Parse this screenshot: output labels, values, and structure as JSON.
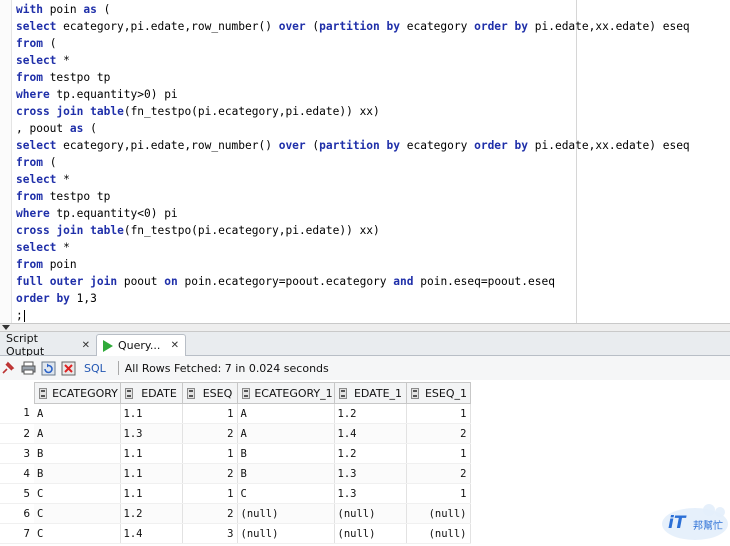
{
  "editor": {
    "lines": [
      [
        {
          "t": "with",
          "k": 1
        },
        {
          "t": " poin "
        },
        {
          "t": "as",
          "k": 1
        },
        {
          "t": " ("
        }
      ],
      [
        {
          "t": "select",
          "k": 1
        },
        {
          "t": " ecategory,pi.edate,row_number() "
        },
        {
          "t": "over",
          "k": 1
        },
        {
          "t": " ("
        },
        {
          "t": "partition",
          "k": 1
        },
        {
          "t": " "
        },
        {
          "t": "by",
          "k": 1
        },
        {
          "t": " ecategory "
        },
        {
          "t": "order",
          "k": 1
        },
        {
          "t": " "
        },
        {
          "t": "by",
          "k": 1
        },
        {
          "t": " pi.edate,xx.edate) eseq"
        }
      ],
      [
        {
          "t": "from",
          "k": 1
        },
        {
          "t": " ("
        }
      ],
      [
        {
          "t": "select",
          "k": 1
        },
        {
          "t": " *"
        }
      ],
      [
        {
          "t": "from",
          "k": 1
        },
        {
          "t": " testpo tp"
        }
      ],
      [
        {
          "t": "where",
          "k": 1
        },
        {
          "t": " tp.equantity>0) pi"
        }
      ],
      [
        {
          "t": "cross",
          "k": 1
        },
        {
          "t": " "
        },
        {
          "t": "join",
          "k": 1
        },
        {
          "t": " "
        },
        {
          "t": "table",
          "k": 1
        },
        {
          "t": "(fn_testpo(pi.ecategory,pi.edate)) xx)"
        }
      ],
      [
        {
          "t": ", poout "
        },
        {
          "t": "as",
          "k": 1
        },
        {
          "t": " ("
        }
      ],
      [
        {
          "t": "select",
          "k": 1
        },
        {
          "t": " ecategory,pi.edate,row_number() "
        },
        {
          "t": "over",
          "k": 1
        },
        {
          "t": " ("
        },
        {
          "t": "partition",
          "k": 1
        },
        {
          "t": " "
        },
        {
          "t": "by",
          "k": 1
        },
        {
          "t": " ecategory "
        },
        {
          "t": "order",
          "k": 1
        },
        {
          "t": " "
        },
        {
          "t": "by",
          "k": 1
        },
        {
          "t": " pi.edate,xx.edate) eseq"
        }
      ],
      [
        {
          "t": "from",
          "k": 1
        },
        {
          "t": " ("
        }
      ],
      [
        {
          "t": "select",
          "k": 1
        },
        {
          "t": " *"
        }
      ],
      [
        {
          "t": "from",
          "k": 1
        },
        {
          "t": " testpo tp"
        }
      ],
      [
        {
          "t": "where",
          "k": 1
        },
        {
          "t": " tp.equantity<0) pi"
        }
      ],
      [
        {
          "t": "cross",
          "k": 1
        },
        {
          "t": " "
        },
        {
          "t": "join",
          "k": 1
        },
        {
          "t": " "
        },
        {
          "t": "table",
          "k": 1
        },
        {
          "t": "(fn_testpo(pi.ecategory,pi.edate)) xx)"
        }
      ],
      [
        {
          "t": "select",
          "k": 1
        },
        {
          "t": " *"
        }
      ],
      [
        {
          "t": "from",
          "k": 1
        },
        {
          "t": " poin"
        }
      ],
      [
        {
          "t": "full",
          "k": 1
        },
        {
          "t": " "
        },
        {
          "t": "outer",
          "k": 1
        },
        {
          "t": " "
        },
        {
          "t": "join",
          "k": 1
        },
        {
          "t": " poout "
        },
        {
          "t": "on",
          "k": 1
        },
        {
          "t": " poin.ecategory=poout.ecategory "
        },
        {
          "t": "and",
          "k": 1
        },
        {
          "t": " poin.eseq=poout.eseq"
        }
      ],
      [
        {
          "t": "order",
          "k": 1
        },
        {
          "t": " "
        },
        {
          "t": "by",
          "k": 1
        },
        {
          "t": " 1,3"
        }
      ],
      [
        {
          "t": ";"
        }
      ]
    ]
  },
  "tabs": {
    "script_output": "Script Output",
    "query_result": "Query...",
    "close_glyph": "✕"
  },
  "toolbar": {
    "sql_label": "SQL",
    "status": "All Rows Fetched: 7 in 0.024 seconds",
    "icons": [
      "pin-icon",
      "print-icon",
      "refresh-icon",
      "export-icon"
    ]
  },
  "grid": {
    "columns": [
      "ECATEGORY",
      "EDATE",
      "ESEQ",
      "ECATEGORY_1",
      "EDATE_1",
      "ESEQ_1"
    ],
    "right_aligned": [
      false,
      false,
      true,
      false,
      false,
      true
    ],
    "rows": [
      [
        "1",
        "A",
        "1.1",
        "1",
        "A",
        "1.2",
        "1"
      ],
      [
        "2",
        "A",
        "1.3",
        "2",
        "A",
        "1.4",
        "2"
      ],
      [
        "3",
        "B",
        "1.1",
        "1",
        "B",
        "1.2",
        "1"
      ],
      [
        "4",
        "B",
        "1.1",
        "2",
        "B",
        "1.3",
        "2"
      ],
      [
        "5",
        "C",
        "1.1",
        "1",
        "C",
        "1.3",
        "1"
      ],
      [
        "6",
        "C",
        "1.2",
        "2",
        "(null)",
        "(null)",
        "(null)"
      ],
      [
        "7",
        "C",
        "1.4",
        "3",
        "(null)",
        "(null)",
        "(null)"
      ]
    ]
  },
  "watermark": {
    "text_main": "iT",
    "text_sub": "邦幫忙"
  },
  "colors": {
    "keyword": "#1f2fa9",
    "play_green": "#2faa3a",
    "sql_link": "#2458b3"
  }
}
